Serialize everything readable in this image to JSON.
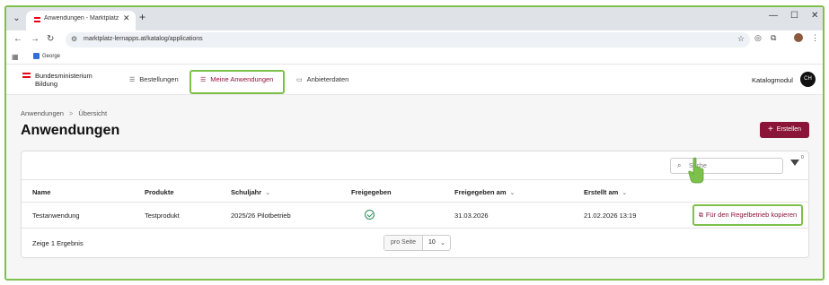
{
  "browser": {
    "tab_title": "Anwendungen - Marktplatz Lerr",
    "url": "marktplatz-lernapps.at/katalog/applications",
    "bookmark": "George"
  },
  "header": {
    "logo_line1": "Bundesministerium",
    "logo_line2": "Bildung",
    "nav": [
      {
        "label": "Bestellungen"
      },
      {
        "label": "Meine Anwendungen"
      },
      {
        "label": "Anbieterdaten"
      }
    ],
    "module": "Katalogmodul",
    "user_initials": "CH"
  },
  "breadcrumb": {
    "parent": "Anwendungen",
    "current": "Übersicht"
  },
  "page_title": "Anwendungen",
  "create_label": "Erstellen",
  "search_placeholder": "Suche",
  "filter_count": "0",
  "table": {
    "headers": [
      "Name",
      "Produkte",
      "Schuljahr",
      "Freigegeben",
      "Freigegeben am",
      "Erstellt am"
    ],
    "rows": [
      {
        "name": "Testanwendung",
        "product": "Testprodukt",
        "schoolyear": "2025/26 Pilotbetrieb",
        "released": true,
        "released_on": "31.03.2026",
        "created_on": "21.02.2026 13:19",
        "action": "Für den Regelbetrieb kopieren"
      }
    ]
  },
  "footer": {
    "result_text": "Zeige 1 Ergebnis",
    "per_page_label": "pro Seite",
    "per_page_value": "10"
  },
  "colors": {
    "accent": "#8a1538",
    "highlight": "#7dc04b"
  }
}
